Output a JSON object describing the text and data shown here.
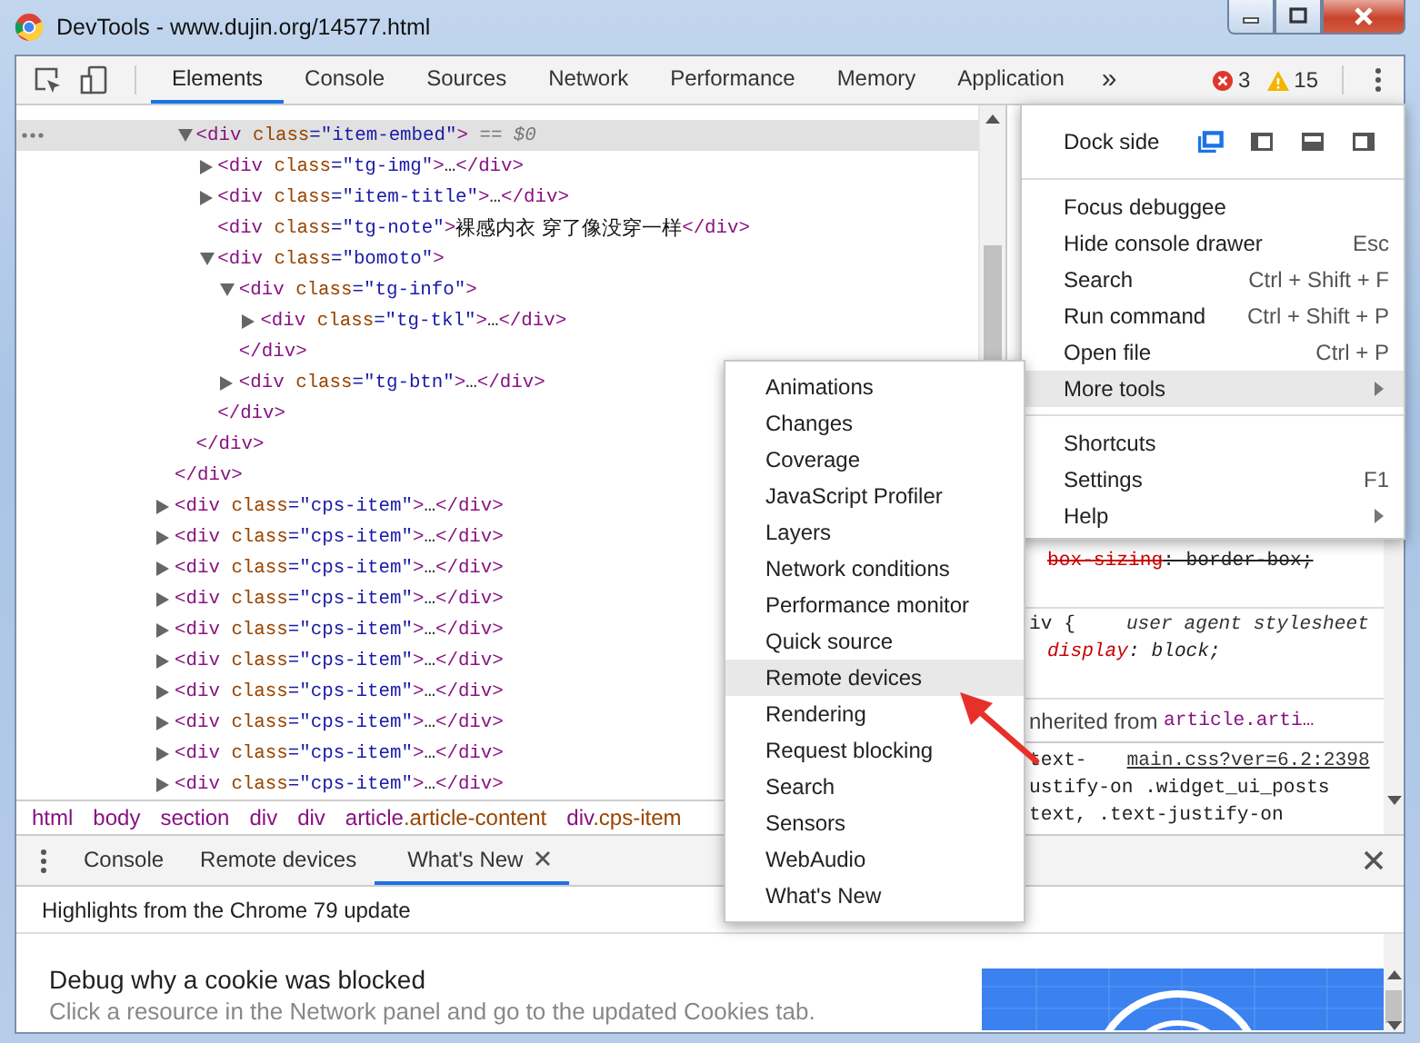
{
  "window": {
    "title": "DevTools - www.dujin.org/14577.html"
  },
  "toolbar": {
    "tabs": [
      {
        "label": "Elements",
        "selected": true
      },
      {
        "label": "Console",
        "selected": false
      },
      {
        "label": "Sources",
        "selected": false
      },
      {
        "label": "Network",
        "selected": false
      },
      {
        "label": "Performance",
        "selected": false
      },
      {
        "label": "Memory",
        "selected": false
      },
      {
        "label": "Application",
        "selected": false
      }
    ],
    "overflow": "»",
    "errors": "3",
    "warnings": "15"
  },
  "tree": {
    "nodes": [
      {
        "close": [
          {
            "kind": "tag",
            "text": "</div>"
          }
        ],
        "children": [
          {
            "parts": [
              {
                "kind": "tag",
                "text": "<div"
              },
              {
                "kind": "attr",
                "text": " class"
              },
              {
                "kind": "value",
                "text": "=\"item-embed\""
              },
              {
                "kind": "tag",
                "text": ">"
              },
              {
                "kind": "marker",
                "text": " == $0"
              }
            ],
            "expanded": true,
            "selected": true,
            "close": [
              {
                "kind": "tag",
                "text": "</div>"
              }
            ],
            "children": [
              {
                "parts": [
                  {
                    "kind": "tag",
                    "text": "<div"
                  },
                  {
                    "kind": "attr",
                    "text": " class"
                  },
                  {
                    "kind": "value",
                    "text": "=\"tg-img\""
                  },
                  {
                    "kind": "tag",
                    "text": ">"
                  },
                  {
                    "kind": "ellipsis",
                    "text": "…"
                  },
                  {
                    "kind": "tag",
                    "text": "</div>"
                  }
                ],
                "expanded": false,
                "selected": false
              },
              {
                "parts": [
                  {
                    "kind": "tag",
                    "text": "<div"
                  },
                  {
                    "kind": "attr",
                    "text": " class"
                  },
                  {
                    "kind": "value",
                    "text": "=\"item-title\""
                  },
                  {
                    "kind": "tag",
                    "text": ">"
                  },
                  {
                    "kind": "ellipsis",
                    "text": "…"
                  },
                  {
                    "kind": "tag",
                    "text": "</div>"
                  }
                ],
                "expanded": false,
                "selected": false
              },
              {
                "parts": [
                  {
                    "kind": "tag",
                    "text": "<div"
                  },
                  {
                    "kind": "attr",
                    "text": " class"
                  },
                  {
                    "kind": "value",
                    "text": "=\"tg-note\""
                  },
                  {
                    "kind": "tag",
                    "text": ">"
                  },
                  {
                    "kind": "text",
                    "text": "裸感内衣 穿了像没穿一样"
                  },
                  {
                    "kind": "tag",
                    "text": "</div>"
                  }
                ],
                "selected": false
              },
              {
                "parts": [
                  {
                    "kind": "tag",
                    "text": "<div"
                  },
                  {
                    "kind": "attr",
                    "text": " class"
                  },
                  {
                    "kind": "value",
                    "text": "=\"bomoto\""
                  },
                  {
                    "kind": "tag",
                    "text": ">"
                  }
                ],
                "expanded": true,
                "selected": false,
                "close": [
                  {
                    "kind": "tag",
                    "text": "</div>"
                  }
                ],
                "children": [
                  {
                    "parts": [
                      {
                        "kind": "tag",
                        "text": "<div"
                      },
                      {
                        "kind": "attr",
                        "text": " class"
                      },
                      {
                        "kind": "value",
                        "text": "=\"tg-info\""
                      },
                      {
                        "kind": "tag",
                        "text": ">"
                      }
                    ],
                    "expanded": true,
                    "selected": false,
                    "close": [
                      {
                        "kind": "tag",
                        "text": "</div>"
                      }
                    ],
                    "children": [
                      {
                        "parts": [
                          {
                            "kind": "tag",
                            "text": "<div"
                          },
                          {
                            "kind": "attr",
                            "text": " class"
                          },
                          {
                            "kind": "value",
                            "text": "=\"tg-tkl\""
                          },
                          {
                            "kind": "tag",
                            "text": ">"
                          },
                          {
                            "kind": "ellipsis",
                            "text": "…"
                          },
                          {
                            "kind": "tag",
                            "text": "</div>"
                          }
                        ],
                        "expanded": false,
                        "selected": false
                      }
                    ]
                  },
                  {
                    "parts": [
                      {
                        "kind": "tag",
                        "text": "<div"
                      },
                      {
                        "kind": "attr",
                        "text": " class"
                      },
                      {
                        "kind": "value",
                        "text": "=\"tg-btn\""
                      },
                      {
                        "kind": "tag",
                        "text": ">"
                      },
                      {
                        "kind": "ellipsis",
                        "text": "…"
                      },
                      {
                        "kind": "tag",
                        "text": "</div>"
                      }
                    ],
                    "expanded": false,
                    "selected": false
                  }
                ]
              }
            ]
          }
        ]
      },
      {
        "parts": [
          {
            "kind": "tag",
            "text": "<div"
          },
          {
            "kind": "attr",
            "text": " class"
          },
          {
            "kind": "value",
            "text": "=\"cps-item\""
          },
          {
            "kind": "tag",
            "text": ">"
          },
          {
            "kind": "ellipsis",
            "text": "…"
          },
          {
            "kind": "tag",
            "text": "</div>"
          }
        ],
        "expanded": false,
        "selected": false
      },
      {
        "parts": [
          {
            "kind": "tag",
            "text": "<div"
          },
          {
            "kind": "attr",
            "text": " class"
          },
          {
            "kind": "value",
            "text": "=\"cps-item\""
          },
          {
            "kind": "tag",
            "text": ">"
          },
          {
            "kind": "ellipsis",
            "text": "…"
          },
          {
            "kind": "tag",
            "text": "</div>"
          }
        ],
        "expanded": false,
        "selected": false
      },
      {
        "parts": [
          {
            "kind": "tag",
            "text": "<div"
          },
          {
            "kind": "attr",
            "text": " class"
          },
          {
            "kind": "value",
            "text": "=\"cps-item\""
          },
          {
            "kind": "tag",
            "text": ">"
          },
          {
            "kind": "ellipsis",
            "text": "…"
          },
          {
            "kind": "tag",
            "text": "</div>"
          }
        ],
        "expanded": false,
        "selected": false
      },
      {
        "parts": [
          {
            "kind": "tag",
            "text": "<div"
          },
          {
            "kind": "attr",
            "text": " class"
          },
          {
            "kind": "value",
            "text": "=\"cps-item\""
          },
          {
            "kind": "tag",
            "text": ">"
          },
          {
            "kind": "ellipsis",
            "text": "…"
          },
          {
            "kind": "tag",
            "text": "</div>"
          }
        ],
        "expanded": false,
        "selected": false
      },
      {
        "parts": [
          {
            "kind": "tag",
            "text": "<div"
          },
          {
            "kind": "attr",
            "text": " class"
          },
          {
            "kind": "value",
            "text": "=\"cps-item\""
          },
          {
            "kind": "tag",
            "text": ">"
          },
          {
            "kind": "ellipsis",
            "text": "…"
          },
          {
            "kind": "tag",
            "text": "</div>"
          }
        ],
        "expanded": false,
        "selected": false
      },
      {
        "parts": [
          {
            "kind": "tag",
            "text": "<div"
          },
          {
            "kind": "attr",
            "text": " class"
          },
          {
            "kind": "value",
            "text": "=\"cps-item\""
          },
          {
            "kind": "tag",
            "text": ">"
          },
          {
            "kind": "ellipsis",
            "text": "…"
          },
          {
            "kind": "tag",
            "text": "</div>"
          }
        ],
        "expanded": false,
        "selected": false
      },
      {
        "parts": [
          {
            "kind": "tag",
            "text": "<div"
          },
          {
            "kind": "attr",
            "text": " class"
          },
          {
            "kind": "value",
            "text": "=\"cps-item\""
          },
          {
            "kind": "tag",
            "text": ">"
          },
          {
            "kind": "ellipsis",
            "text": "…"
          },
          {
            "kind": "tag",
            "text": "</div>"
          }
        ],
        "expanded": false,
        "selected": false
      },
      {
        "parts": [
          {
            "kind": "tag",
            "text": "<div"
          },
          {
            "kind": "attr",
            "text": " class"
          },
          {
            "kind": "value",
            "text": "=\"cps-item\""
          },
          {
            "kind": "tag",
            "text": ">"
          },
          {
            "kind": "ellipsis",
            "text": "…"
          },
          {
            "kind": "tag",
            "text": "</div>"
          }
        ],
        "expanded": false,
        "selected": false
      },
      {
        "parts": [
          {
            "kind": "tag",
            "text": "<div"
          },
          {
            "kind": "attr",
            "text": " class"
          },
          {
            "kind": "value",
            "text": "=\"cps-item\""
          },
          {
            "kind": "tag",
            "text": ">"
          },
          {
            "kind": "ellipsis",
            "text": "…"
          },
          {
            "kind": "tag",
            "text": "</div>"
          }
        ],
        "expanded": false,
        "selected": false
      },
      {
        "parts": [
          {
            "kind": "tag",
            "text": "<div"
          },
          {
            "kind": "attr",
            "text": " class"
          },
          {
            "kind": "value",
            "text": "=\"cps-item\""
          },
          {
            "kind": "tag",
            "text": ">"
          },
          {
            "kind": "ellipsis",
            "text": "…"
          },
          {
            "kind": "tag",
            "text": "</div>"
          }
        ],
        "expanded": false,
        "selected": false
      }
    ]
  },
  "breadcrumbs": [
    {
      "tag": "html"
    },
    {
      "tag": "body"
    },
    {
      "tag": "section"
    },
    {
      "tag": "div"
    },
    {
      "tag": "div"
    },
    {
      "tag": "article",
      "cls": ".article-content"
    },
    {
      "tag": "div",
      "cls": ".cps-item"
    }
  ],
  "styles": {
    "sections": [
      {
        "kind": "rule",
        "lines": [
          {
            "kind": "declaration",
            "overridden": true,
            "parts": [
              {
                "kind": "property",
                "text": "box-sizing"
              },
              {
                "kind": "value",
                "text": ": border-box;"
              }
            ]
          }
        ]
      },
      {
        "kind": "rule",
        "lines": [
          {
            "kind": "selector",
            "parts": [
              {
                "kind": "selector",
                "text": "iv {"
              },
              {
                "kind": "origin",
                "text": "user agent stylesheet"
              }
            ]
          },
          {
            "kind": "declaration",
            "overridden": false,
            "parts": [
              {
                "kind": "property",
                "text": "display"
              },
              {
                "kind": "value",
                "text": ": block;"
              }
            ]
          }
        ]
      },
      {
        "kind": "inherited",
        "lines": [
          {
            "kind": "selector",
            "parts": [
              {
                "kind": "label",
                "text": "nherited from "
              },
              {
                "kind": "element",
                "text": "article.arti…"
              }
            ]
          }
        ]
      },
      {
        "kind": "rule",
        "lines": [
          {
            "kind": "selector",
            "parts": [
              {
                "kind": "selector",
                "text": "text-"
              },
              {
                "kind": "link",
                "text": "main.css?ver=6.2:2398"
              }
            ]
          },
          {
            "kind": "selector",
            "parts": [
              {
                "kind": "selector",
                "text": "ustify-on .widget_ui_posts"
              }
            ]
          },
          {
            "kind": "selector",
            "parts": [
              {
                "kind": "selector",
                "text": "text, .text-justify-on"
              }
            ]
          }
        ]
      }
    ]
  },
  "drawer": {
    "tabs": [
      {
        "label": "Console",
        "selected": false,
        "closable": false
      },
      {
        "label": "Remote devices",
        "selected": false,
        "closable": false
      },
      {
        "label": "What's New",
        "selected": true,
        "closable": true
      }
    ],
    "header": "Highlights from the Chrome 79 update",
    "article": {
      "title": "Debug why a cookie was blocked",
      "description": "Click a resource in the Network panel and go to the updated Cookies tab."
    }
  },
  "main_menu": {
    "dock_side": {
      "label": "Dock side",
      "options": [
        {
          "kind": "undocked",
          "selected": true
        },
        {
          "kind": "left",
          "selected": false
        },
        {
          "kind": "bottom",
          "selected": false
        },
        {
          "kind": "right",
          "selected": false
        }
      ]
    },
    "groups": [
      {
        "items": [
          {
            "label": "Focus debuggee",
            "selected": false,
            "submenu": false
          },
          {
            "label": "Hide console drawer",
            "shortcut": "Esc",
            "selected": false,
            "submenu": false
          },
          {
            "label": "Search",
            "shortcut": "Ctrl + Shift + F",
            "selected": false,
            "submenu": false
          },
          {
            "label": "Run command",
            "shortcut": "Ctrl + Shift + P",
            "selected": false,
            "submenu": false
          },
          {
            "label": "Open file",
            "shortcut": "Ctrl + P",
            "selected": false,
            "submenu": false
          },
          {
            "label": "More tools",
            "selected": true,
            "submenu": true
          }
        ]
      },
      {
        "items": [
          {
            "label": "Shortcuts",
            "selected": false,
            "submenu": false
          },
          {
            "label": "Settings",
            "shortcut": "F1",
            "selected": false,
            "submenu": false
          },
          {
            "label": "Help",
            "selected": false,
            "submenu": true
          }
        ]
      }
    ]
  },
  "more_tools_menu": {
    "items": [
      {
        "label": "Animations",
        "selected": false
      },
      {
        "label": "Changes",
        "selected": false
      },
      {
        "label": "Coverage",
        "selected": false
      },
      {
        "label": "JavaScript Profiler",
        "selected": false
      },
      {
        "label": "Layers",
        "selected": false
      },
      {
        "label": "Network conditions",
        "selected": false
      },
      {
        "label": "Performance monitor",
        "selected": false
      },
      {
        "label": "Quick source",
        "selected": false
      },
      {
        "label": "Remote devices",
        "selected": true
      },
      {
        "label": "Rendering",
        "selected": false
      },
      {
        "label": "Request blocking",
        "selected": false
      },
      {
        "label": "Search",
        "selected": false
      },
      {
        "label": "Sensors",
        "selected": false
      },
      {
        "label": "WebAudio",
        "selected": false
      },
      {
        "label": "What's New",
        "selected": false
      }
    ]
  }
}
